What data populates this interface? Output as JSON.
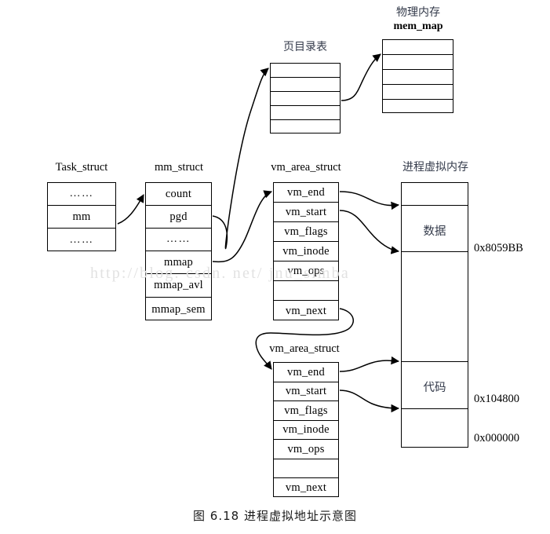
{
  "caption": "图 6.18    进程虚拟地址示意图",
  "watermark": "http://blog. csdn. net/ jnu_simba",
  "colors": {
    "stroke": "#000000",
    "chinese_text": "#333a4a",
    "watermark": "#e2e2e2",
    "background": "#ffffff"
  },
  "structs": {
    "task_struct": {
      "title": "Task_struct",
      "rows": [
        "……",
        "mm",
        "……"
      ]
    },
    "mm_struct": {
      "title": "mm_struct",
      "rows": [
        "count",
        "pgd",
        "……",
        "mmap",
        "mmap_avl",
        "mmap_sem"
      ]
    },
    "vm_area_struct_1": {
      "title": "vm_area_struct",
      "rows": [
        "vm_end",
        "vm_start",
        "vm_flags",
        "vm_inode",
        "vm_ops",
        "",
        "vm_next"
      ]
    },
    "vm_area_struct_2": {
      "title": "vm_area_struct",
      "rows": [
        "vm_end",
        "vm_start",
        "vm_flags",
        "vm_inode",
        "vm_ops",
        "",
        "vm_next"
      ]
    },
    "page_dir_table": {
      "title": "页目录表",
      "rows": [
        "",
        "",
        "",
        "",
        ""
      ]
    },
    "mem_map": {
      "title_cn": "物理内存",
      "title_en": "mem_map",
      "rows": [
        "",
        "",
        "",
        "",
        ""
      ]
    },
    "process_vm": {
      "title": "进程虚拟内存",
      "segments": [
        {
          "label": "",
          "name": "top-gap"
        },
        {
          "label": "数据",
          "name": "data-segment"
        },
        {
          "label": "",
          "name": "middle-gap"
        },
        {
          "label": "代码",
          "name": "code-segment"
        },
        {
          "label": "",
          "name": "bottom-gap"
        }
      ],
      "addresses": [
        "0x8059BB",
        "0x104800",
        "0x000000"
      ]
    }
  }
}
